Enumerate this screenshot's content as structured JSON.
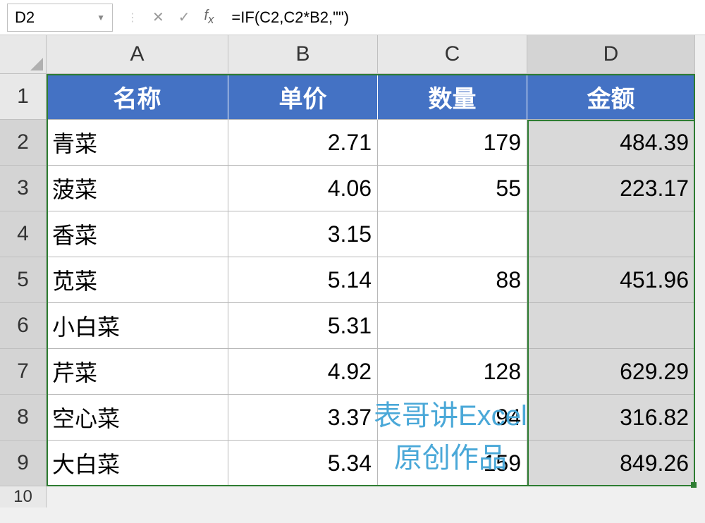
{
  "nameBox": {
    "value": "D2"
  },
  "formulaBar": {
    "value": "=IF(C2,C2*B2,\"\")"
  },
  "columnHeaders": [
    "A",
    "B",
    "C",
    "D"
  ],
  "rowHeaders": [
    "1",
    "2",
    "3",
    "4",
    "5",
    "6",
    "7",
    "8",
    "9",
    "10"
  ],
  "tableHeader": {
    "name": "名称",
    "price": "单价",
    "quantity": "数量",
    "amount": "金额"
  },
  "rows": [
    {
      "name": "青菜",
      "price": "2.71",
      "quantity": "179",
      "amount": "484.39"
    },
    {
      "name": "菠菜",
      "price": "4.06",
      "quantity": "55",
      "amount": "223.17"
    },
    {
      "name": "香菜",
      "price": "3.15",
      "quantity": "",
      "amount": ""
    },
    {
      "name": "苋菜",
      "price": "5.14",
      "quantity": "88",
      "amount": "451.96"
    },
    {
      "name": "小白菜",
      "price": "5.31",
      "quantity": "",
      "amount": ""
    },
    {
      "name": "芹菜",
      "price": "4.92",
      "quantity": "128",
      "amount": "629.29"
    },
    {
      "name": "空心菜",
      "price": "3.37",
      "quantity": "94",
      "amount": "316.82"
    },
    {
      "name": "大白菜",
      "price": "5.34",
      "quantity": "159",
      "amount": "849.26"
    }
  ],
  "watermark": {
    "line1": "表哥讲Excel",
    "line2": "原创作品"
  }
}
